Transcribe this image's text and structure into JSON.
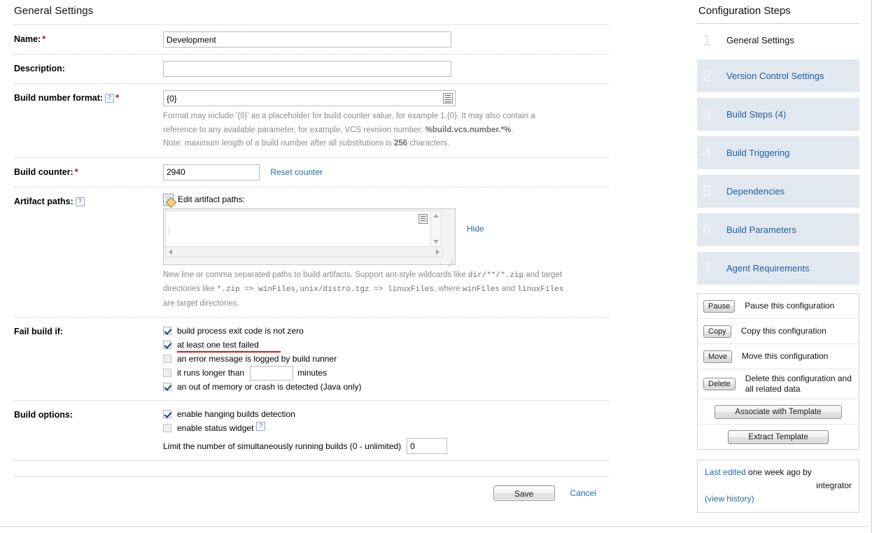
{
  "main": {
    "title": "General Settings",
    "fields": {
      "name": {
        "label": "Name:",
        "value": "Development",
        "required": "*"
      },
      "description": {
        "label": "Description:",
        "value": "",
        "placeholder": ""
      },
      "build_number_format": {
        "label": "Build number format:",
        "value": "{0}",
        "required": "*",
        "help_icon": "?",
        "hint_line1_a": "Format may include '{0}' as a placeholder for build counter value, for example 1.{0}. It may also contain a",
        "hint_line2_a": "reference to any available parameter, for example, VCS revision number: ",
        "hint_line2_b": "%build.vcs.number.*%",
        "hint_line2_c": ".",
        "hint_line3_a": "Note: maximum length of a build number after all substitutions is ",
        "hint_line3_b": "256",
        "hint_line3_c": " characters."
      },
      "build_counter": {
        "label": "Build counter:",
        "value": "2940",
        "required": "*",
        "reset_link": "Reset counter"
      },
      "artifact_paths": {
        "label": "Artifact paths:",
        "help_icon": "?",
        "editor_label": "Edit artifact paths:",
        "editor_value": "",
        "hide_link": "Hide",
        "hint_1a": "New line or comma separated paths to build artifacts. Support ant-style wildcards like ",
        "hint_1b": "dir/**/*.zip",
        "hint_1c": " and target",
        "hint_2a": "directories like ",
        "hint_2b": "*.zip => winFiles,unix/distro.tgz => linuxFiles",
        "hint_2c": ", where ",
        "hint_2d": "winFiles",
        "hint_2e": " and ",
        "hint_2f": "linuxFiles",
        "hint_3a": "are target directories."
      }
    },
    "fail_build_if": {
      "label": "Fail build if:",
      "options": [
        {
          "label": "build process exit code is not zero",
          "checked": true,
          "underlined": false
        },
        {
          "label": "at least one test failed",
          "checked": true,
          "underlined": true
        },
        {
          "label": "an error message is logged by build runner",
          "checked": false,
          "underlined": false
        },
        {
          "label": "it runs longer than",
          "checked": false,
          "underlined": false,
          "suffix": "minutes",
          "input_value": ""
        },
        {
          "label": "an out of memory or crash is detected (Java only)",
          "checked": true,
          "underlined": false
        }
      ]
    },
    "build_options": {
      "label": "Build options:",
      "options": [
        {
          "label": "enable hanging builds detection",
          "checked": true,
          "help_icon": ""
        },
        {
          "label": "enable status widget",
          "checked": false,
          "help_icon": "?"
        }
      ],
      "limit_text": "Limit the number of simultaneously running builds (0 - unlimited)",
      "limit_value": "0"
    },
    "footer": {
      "save_label": "Save",
      "cancel_label": "Cancel"
    }
  },
  "sidebar": {
    "title": "Configuration Steps",
    "steps": [
      {
        "num": "1",
        "label": "General Settings",
        "current": true
      },
      {
        "num": "2",
        "label": "Version Control Settings",
        "current": false
      },
      {
        "num": "3",
        "label": "Build Steps (4)",
        "current": false
      },
      {
        "num": "4",
        "label": "Build Triggering",
        "current": false
      },
      {
        "num": "5",
        "label": "Dependencies",
        "current": false
      },
      {
        "num": "6",
        "label": "Build Parameters",
        "current": false
      },
      {
        "num": "7",
        "label": "Agent Requirements",
        "current": false
      }
    ],
    "actions": [
      {
        "button": "Pause",
        "desc": "Pause this configuration"
      },
      {
        "button": "Copy",
        "desc": "Copy this configuration"
      },
      {
        "button": "Move",
        "desc": "Move this configuration"
      },
      {
        "button": "Delete",
        "desc": "Delete this configuration and all related data"
      }
    ],
    "template_buttons": {
      "associate": "Associate with Template",
      "extract": "Extract Template"
    },
    "last_edited": {
      "link": "Last edited",
      "text": " one week ago by",
      "user": "integrator",
      "history_link": "(view history)"
    }
  },
  "colors": {
    "link": "#1c5fa8",
    "required": "#cc0000",
    "underline": "#d11a1a",
    "step_alt_bg": "#e2e8ef"
  }
}
